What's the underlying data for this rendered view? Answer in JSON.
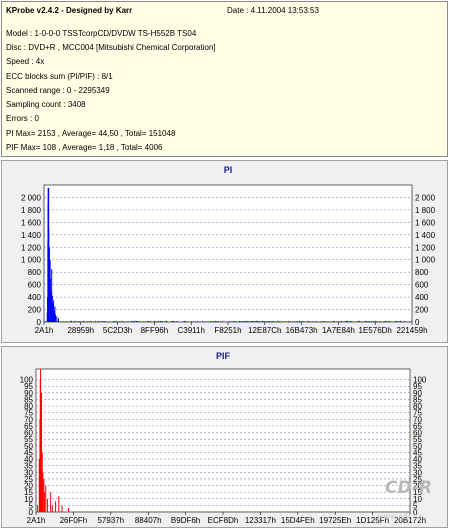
{
  "info": {
    "title": "KProbe v2.4.2 - Designed by Karr",
    "date": "Date : 4.11.2004 13:53:53",
    "lines": [
      "Model : 1-0-0-0 TSSTcorpCD/DVDW TS-H552B TS04",
      "Disc : DVD+R , MCC004 [Mitsubishi Chemical Corporation]",
      "Speed : 4x",
      "ECC blocks sum (PI/PIF) : 8/1",
      "Scanned range : 0 - 2295349",
      "Sampling count : 3408",
      "Errors : 0",
      "PI Max= 2153 , Average= 44,50 , Total= 151048",
      "PIF Max= 108 , Average= 1,18 , Total= 4006"
    ]
  },
  "watermark": {
    "logo": "CD-R",
    "url": "www.cdr.cz"
  },
  "colors": {
    "pi": "#0000ff",
    "pif": "#ff0000",
    "grid": "#7070c0",
    "title": "#1c1c9c"
  },
  "chart_data": [
    {
      "type": "bar",
      "title": "PI",
      "ylim": [
        0,
        2200
      ],
      "yticks": [
        0,
        200,
        400,
        600,
        800,
        1000,
        1200,
        1400,
        1600,
        1800,
        2000
      ],
      "ytick_labels": [
        "0",
        "200",
        "400",
        "600",
        "800",
        "1 000",
        "1 200",
        "1 400",
        "1 600",
        "1 800",
        "2 000"
      ],
      "xticks": [
        "2A1h",
        "28959h",
        "5C2D3h",
        "8FF96h",
        "C3911h",
        "F8251h",
        "12E87Ch",
        "16B473h",
        "1A7E84h",
        "1E576Dh",
        "221459h"
      ],
      "x_range": [
        0,
        2295349
      ],
      "grid": true,
      "peak": 2153,
      "spikes": [
        {
          "x": 229.5349,
          "y": 0
        },
        {
          "x": 20000,
          "y": 150
        },
        {
          "x": 22000,
          "y": 400
        },
        {
          "x": 24000,
          "y": 1300
        },
        {
          "x": 25000,
          "y": 1900
        },
        {
          "x": 26000,
          "y": 2153
        },
        {
          "x": 27000,
          "y": 2050
        },
        {
          "x": 28000,
          "y": 1700
        },
        {
          "x": 29000,
          "y": 2153
        },
        {
          "x": 30000,
          "y": 1500
        },
        {
          "x": 32000,
          "y": 900
        },
        {
          "x": 34000,
          "y": 1200
        },
        {
          "x": 36000,
          "y": 600
        },
        {
          "x": 38000,
          "y": 1000
        },
        {
          "x": 40000,
          "y": 700
        },
        {
          "x": 44000,
          "y": 500
        },
        {
          "x": 48000,
          "y": 850
        },
        {
          "x": 52000,
          "y": 420
        },
        {
          "x": 56000,
          "y": 300
        },
        {
          "x": 60000,
          "y": 350
        },
        {
          "x": 64000,
          "y": 180
        },
        {
          "x": 68000,
          "y": 250
        },
        {
          "x": 72000,
          "y": 120
        },
        {
          "x": 80000,
          "y": 90
        },
        {
          "x": 90000,
          "y": 60
        }
      ],
      "baseline": 20
    },
    {
      "type": "bar",
      "title": "PIF",
      "ylim": [
        0,
        108
      ],
      "yticks": [
        0,
        5,
        10,
        15,
        20,
        25,
        30,
        35,
        40,
        45,
        50,
        55,
        60,
        65,
        70,
        75,
        80,
        85,
        90,
        95,
        100
      ],
      "ytick_labels": [
        "0",
        "5",
        "10",
        "15",
        "20",
        "25",
        "30",
        "35",
        "40",
        "45",
        "50",
        "55",
        "60",
        "65",
        "70",
        "75",
        "80",
        "85",
        "90",
        "95",
        "100"
      ],
      "xticks": [
        "2A1h",
        "26F0Fh",
        "57937h",
        "88407h",
        "B9DF6h",
        "ECF8Dh",
        "123317h",
        "15D4FEh",
        "19725Eh",
        "1D125Fh",
        "20B172h"
      ],
      "x_range": [
        0,
        2295349
      ],
      "grid": true,
      "peak": 108,
      "spikes": [
        {
          "x": 10000,
          "y": 5
        },
        {
          "x": 20000,
          "y": 40
        },
        {
          "x": 24000,
          "y": 70
        },
        {
          "x": 26000,
          "y": 100
        },
        {
          "x": 28000,
          "y": 108
        },
        {
          "x": 30000,
          "y": 60
        },
        {
          "x": 34000,
          "y": 90
        },
        {
          "x": 38000,
          "y": 45
        },
        {
          "x": 42000,
          "y": 30
        },
        {
          "x": 48000,
          "y": 25
        },
        {
          "x": 52000,
          "y": 15
        },
        {
          "x": 60000,
          "y": 20
        },
        {
          "x": 70000,
          "y": 10
        },
        {
          "x": 90000,
          "y": 15
        },
        {
          "x": 100000,
          "y": 5
        },
        {
          "x": 120000,
          "y": 8
        },
        {
          "x": 140000,
          "y": 12
        },
        {
          "x": 160000,
          "y": 5
        },
        {
          "x": 200000,
          "y": 3
        }
      ]
    }
  ]
}
